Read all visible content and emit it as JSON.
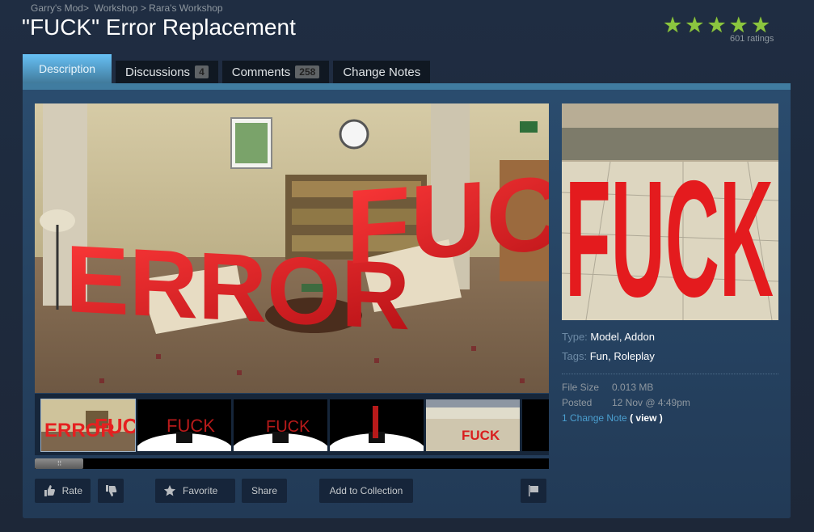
{
  "breadcrumb": {
    "items": [
      "Garry's Mod",
      "Workshop",
      "Rara's Workshop"
    ],
    "separators": [
      ">",
      ">"
    ]
  },
  "title": "\"FUCK\" Error Replacement",
  "rating": {
    "stars": 5,
    "max_stars": 5,
    "star_glyph": "★",
    "count_label": "601 ratings",
    "color": "#8bc53f"
  },
  "tabs": [
    {
      "label": "Description",
      "active": true
    },
    {
      "label": "Discussions",
      "badge": "4"
    },
    {
      "label": "Comments",
      "badge": "258"
    },
    {
      "label": "Change Notes"
    }
  ],
  "media": {
    "main_scene_words": [
      "ERROR",
      "FUCK"
    ],
    "thumbnails": [
      {
        "kind": "room",
        "words": [
          "ERROR",
          "FUCK"
        ],
        "selected": true
      },
      {
        "kind": "spotlight",
        "word": "FUCK"
      },
      {
        "kind": "spotlight",
        "word": "FUCK"
      },
      {
        "kind": "spotlight",
        "word": "I"
      },
      {
        "kind": "courtyard",
        "word": "FUCK"
      }
    ],
    "preview_word": "FUCK"
  },
  "buttons": {
    "rate": "Rate",
    "favorite": "Favorite",
    "share": "Share",
    "add_to_collection": "Add to Collection"
  },
  "details": {
    "type_label": "Type:",
    "type_values": "Model, Addon",
    "tags_label": "Tags:",
    "tags_values": "Fun, Roleplay",
    "file_size_label": "File Size",
    "file_size": "0.013 MB",
    "posted_label": "Posted",
    "posted": "12 Nov @ 4:49pm",
    "change_note": "1 Change Note",
    "view_label": "( view )"
  }
}
